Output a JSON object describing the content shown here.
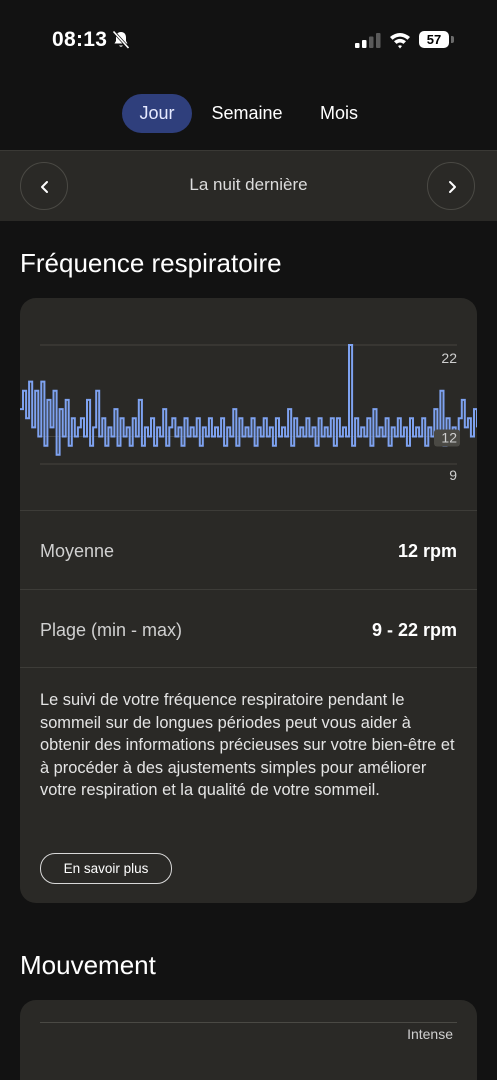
{
  "status": {
    "time": "08:13",
    "battery": "57"
  },
  "tabs": [
    {
      "label": "Jour",
      "active": true
    },
    {
      "label": "Semaine",
      "active": false
    },
    {
      "label": "Mois",
      "active": false
    }
  ],
  "date_nav": {
    "title": "La nuit dernière"
  },
  "respiratory": {
    "title": "Fréquence respiratoire",
    "stats": [
      {
        "label": "Moyenne",
        "value": "12 rpm"
      },
      {
        "label": "Plage (min - max)",
        "value": "9 - 22 rpm"
      }
    ],
    "description": "Le suivi de votre fréquence respiratoire pendant le sommeil sur de longues périodes peut vous aider à obtenir des informations précieuses sur votre bien-être et à procéder à des ajustements simples pour améliorer votre respiration et la qualité de votre sommeil.",
    "learn_more": "En savoir plus"
  },
  "chart_data": {
    "type": "line",
    "y_ticks": [
      "22",
      "12",
      "9"
    ],
    "y_tick_values": [
      22,
      12,
      9
    ],
    "ylim": [
      9,
      22
    ],
    "average": 12,
    "min": 9,
    "max": 22,
    "series_color": "#7ea2f0",
    "values": [
      15,
      17,
      14,
      18,
      13,
      17,
      12,
      18,
      11,
      16,
      13,
      17,
      10,
      15,
      12,
      16,
      11,
      14,
      12,
      13,
      14,
      12,
      16,
      11,
      13,
      17,
      12,
      14,
      11,
      13,
      12,
      15,
      11,
      14,
      12,
      13,
      11,
      14,
      12,
      16,
      11,
      13,
      12,
      14,
      11,
      13,
      12,
      15,
      11,
      13,
      14,
      12,
      13,
      11,
      14,
      12,
      13,
      12,
      14,
      11,
      13,
      12,
      14,
      12,
      13,
      12,
      14,
      11,
      13,
      12,
      15,
      11,
      14,
      12,
      13,
      12,
      14,
      11,
      13,
      12,
      14,
      12,
      13,
      11,
      14,
      12,
      13,
      12,
      15,
      11,
      14,
      12,
      13,
      12,
      14,
      12,
      13,
      11,
      14,
      12,
      13,
      12,
      14,
      11,
      14,
      12,
      13,
      12,
      22,
      11,
      14,
      12,
      13,
      12,
      14,
      11,
      15,
      12,
      13,
      12,
      14,
      11,
      13,
      12,
      14,
      12,
      13,
      11,
      14,
      12,
      13,
      12,
      14,
      11,
      13,
      12,
      15,
      12,
      17,
      11,
      14,
      12,
      13,
      12,
      14,
      16,
      13,
      14,
      12,
      15,
      13
    ]
  },
  "movement": {
    "title": "Mouvement",
    "legend": "Intense"
  }
}
